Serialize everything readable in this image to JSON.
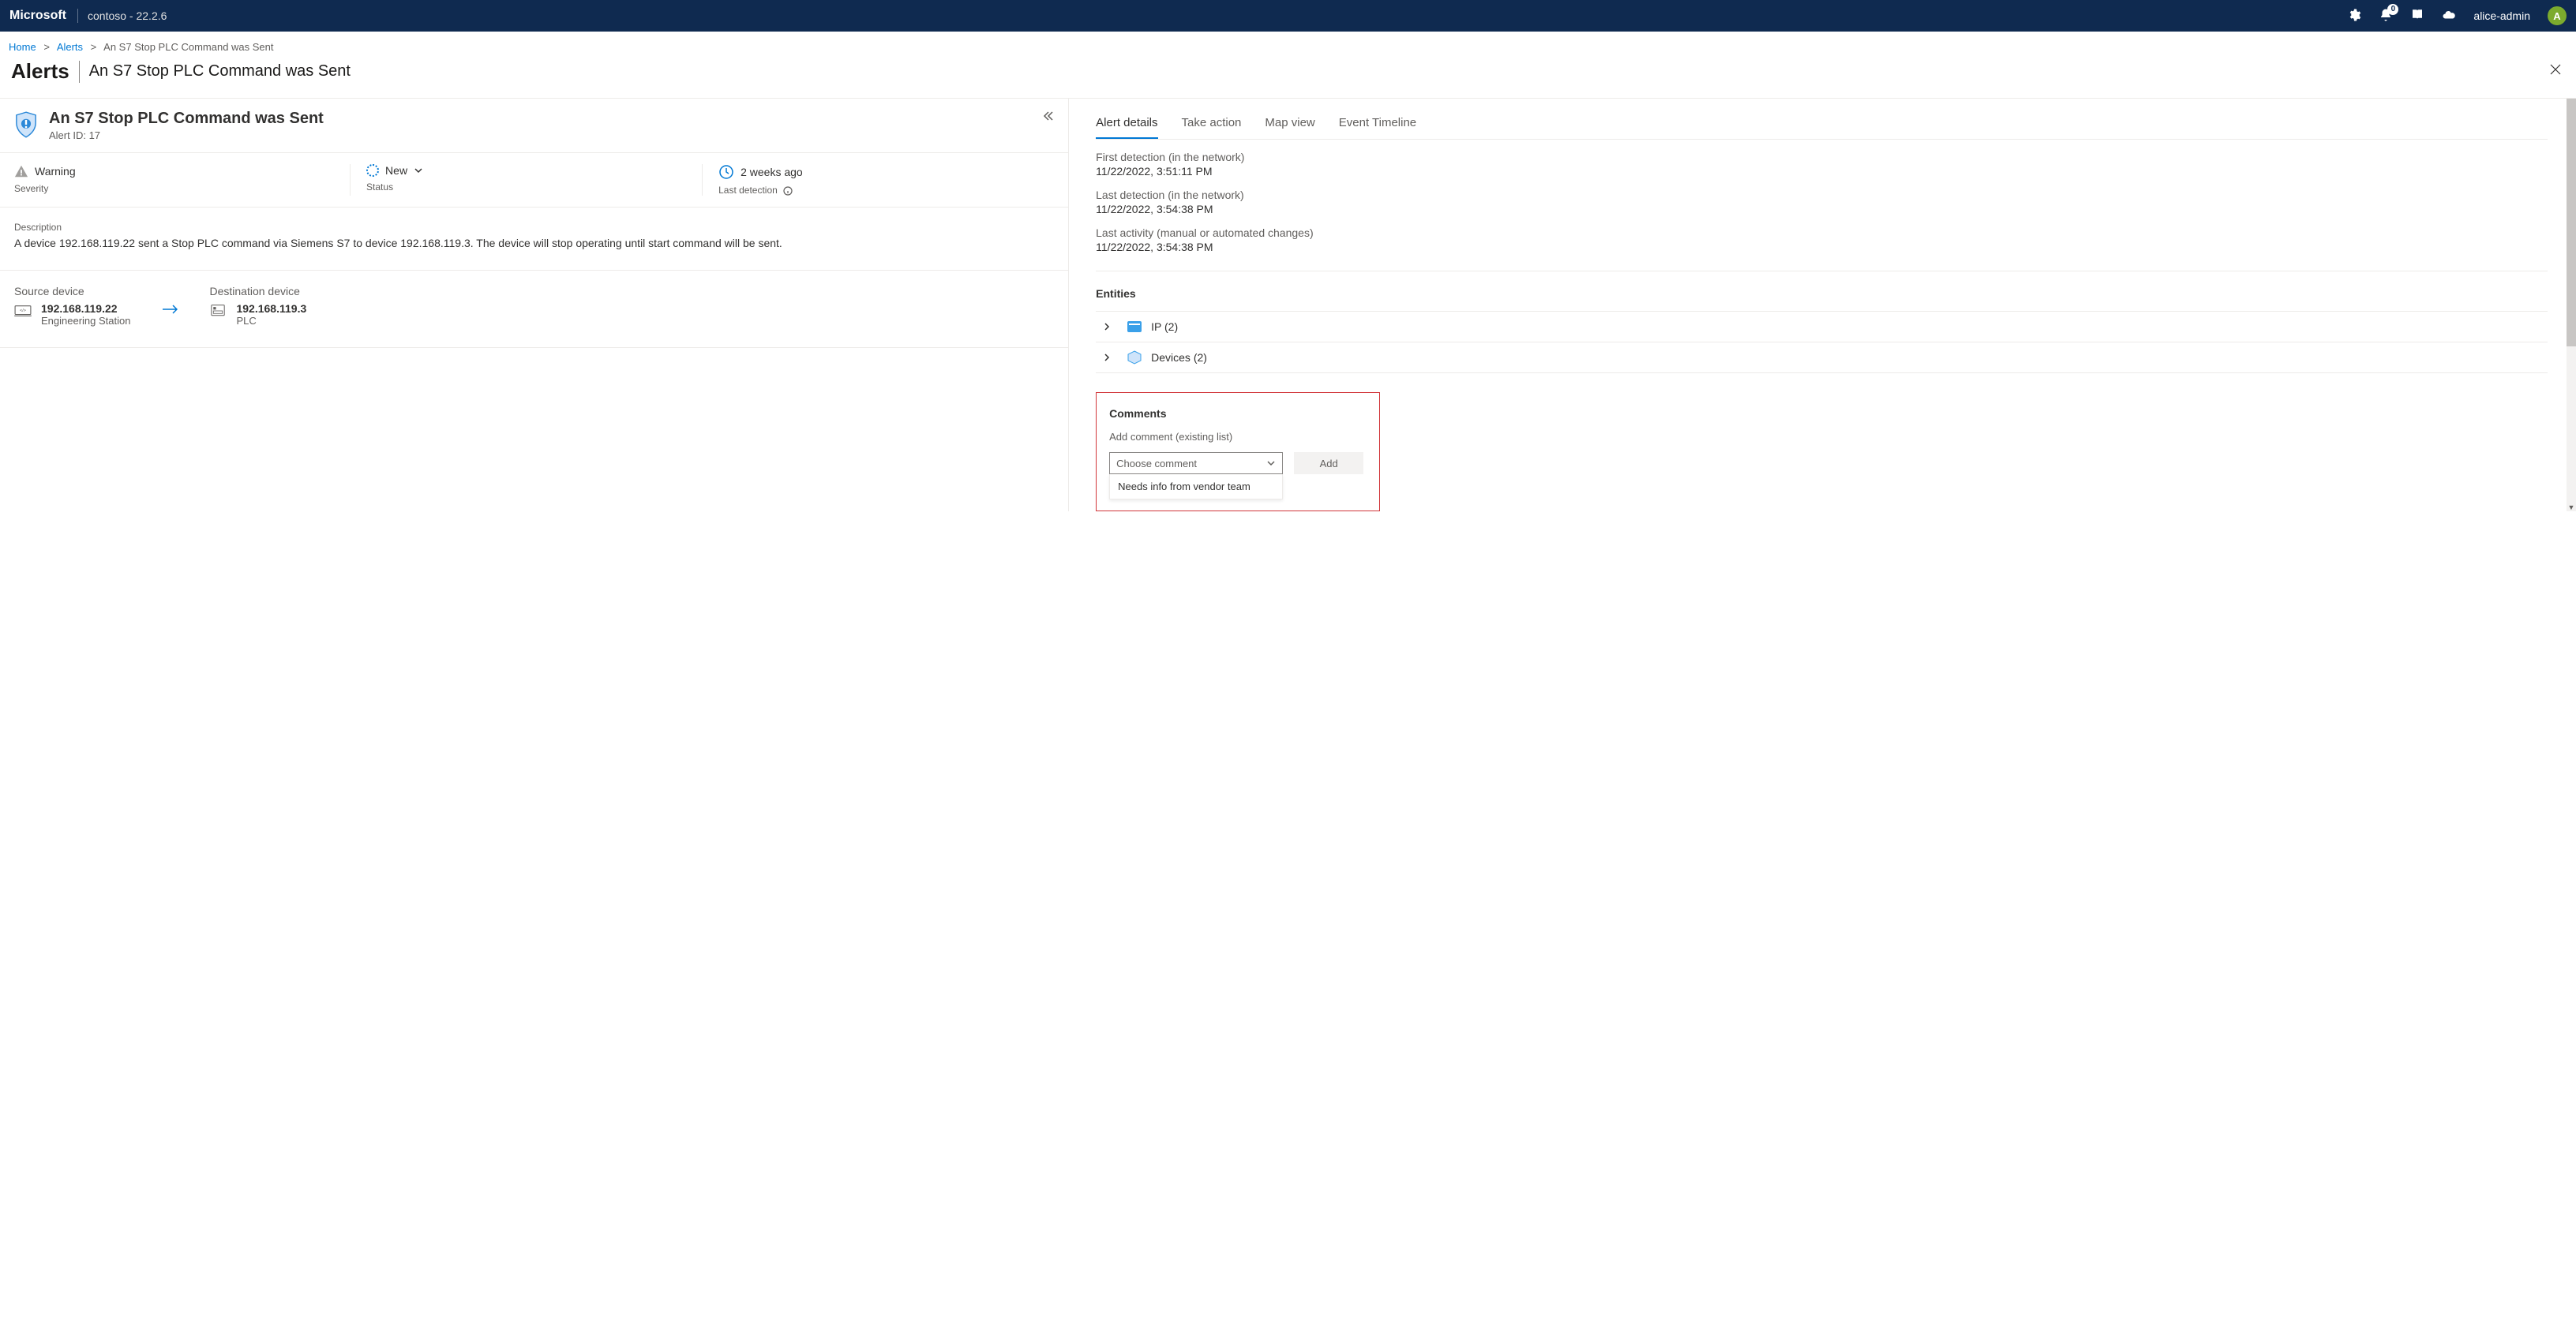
{
  "topnav": {
    "brand": "Microsoft",
    "tenant": "contoso - 22.2.6",
    "notification_count": "0",
    "username": "alice-admin",
    "avatar_letter": "A"
  },
  "breadcrumbs": {
    "home": "Home",
    "alerts": "Alerts",
    "current": "An S7 Stop PLC Command was Sent"
  },
  "page": {
    "title": "Alerts",
    "subtitle": "An S7 Stop PLC Command was Sent"
  },
  "alert": {
    "title": "An S7 Stop PLC Command was Sent",
    "id_label": "Alert ID: 17",
    "severity_label": "Severity",
    "severity_value": "Warning",
    "status_label": "Status",
    "status_value": "New",
    "last_detection_label": "Last detection",
    "last_detection_value": "2 weeks ago",
    "description_label": "Description",
    "description_text": "A device 192.168.119.22 sent a Stop PLC command via Siemens S7 to device 192.168.119.3. The device will stop operating until start command will be sent."
  },
  "devices": {
    "source_label": "Source device",
    "source_ip": "192.168.119.22",
    "source_type": "Engineering Station",
    "dest_label": "Destination device",
    "dest_ip": "192.168.119.3",
    "dest_type": "PLC"
  },
  "tabs": {
    "details": "Alert details",
    "action": "Take action",
    "map": "Map view",
    "timeline": "Event Timeline"
  },
  "detections": {
    "first_label": "First detection (in the network)",
    "first_value": "11/22/2022, 3:51:11 PM",
    "last_label": "Last detection (in the network)",
    "last_value": "11/22/2022, 3:54:38 PM",
    "activity_label": "Last activity (manual or automated changes)",
    "activity_value": "11/22/2022, 3:54:38 PM"
  },
  "entities": {
    "heading": "Entities",
    "ip_label": "IP (2)",
    "devices_label": "Devices (2)"
  },
  "comments": {
    "heading": "Comments",
    "sub": "Add comment (existing list)",
    "placeholder": "Choose comment",
    "add_label": "Add",
    "option1": "Needs info from vendor team"
  }
}
